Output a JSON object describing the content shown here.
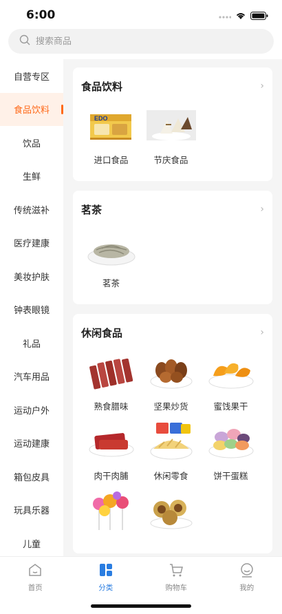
{
  "status": {
    "time": "6:00"
  },
  "search": {
    "placeholder": "搜索商品"
  },
  "sidebar": {
    "items": [
      {
        "label": "自营专区",
        "active": false
      },
      {
        "label": "食品饮料",
        "active": true
      },
      {
        "label": "饮品",
        "active": false
      },
      {
        "label": "生鲜",
        "active": false
      },
      {
        "label": "传统滋补",
        "active": false
      },
      {
        "label": "医疗建康",
        "active": false
      },
      {
        "label": "美妆护肤",
        "active": false
      },
      {
        "label": "钟表眼镜",
        "active": false
      },
      {
        "label": "礼品",
        "active": false
      },
      {
        "label": "汽车用品",
        "active": false
      },
      {
        "label": "运动户外",
        "active": false
      },
      {
        "label": "运动建康",
        "active": false
      },
      {
        "label": "箱包皮具",
        "active": false
      },
      {
        "label": "玩具乐器",
        "active": false
      },
      {
        "label": "儿童",
        "active": false
      }
    ]
  },
  "sections": [
    {
      "title": "食品饮料",
      "items": [
        {
          "label": "进口食品",
          "icon": "biscuit-box-image"
        },
        {
          "label": "节庆食品",
          "icon": "rice-dumpling-image"
        }
      ]
    },
    {
      "title": "茗茶",
      "items": [
        {
          "label": "茗茶",
          "icon": "tea-leaves-image"
        }
      ]
    },
    {
      "title": "休闲食品",
      "items": [
        {
          "label": "熟食腊味",
          "icon": "cured-meat-image"
        },
        {
          "label": "坚果炒货",
          "icon": "pecan-nuts-image"
        },
        {
          "label": "蜜饯果干",
          "icon": "dried-mango-image"
        },
        {
          "label": "肉干肉脯",
          "icon": "jerky-image"
        },
        {
          "label": "休闲零食",
          "icon": "chips-snack-image"
        },
        {
          "label": "饼干蛋糕",
          "icon": "macaron-image"
        },
        {
          "label": "",
          "icon": "lollipop-image"
        },
        {
          "label": "",
          "icon": "chocolate-ball-image"
        }
      ]
    }
  ],
  "tabbar": {
    "items": [
      {
        "label": "首页",
        "icon": "home-icon",
        "active": false
      },
      {
        "label": "分类",
        "icon": "category-icon",
        "active": true
      },
      {
        "label": "购物车",
        "icon": "cart-icon",
        "active": false
      },
      {
        "label": "我的",
        "icon": "profile-icon",
        "active": false
      }
    ]
  },
  "colors": {
    "accent": "#ff6a1a",
    "tab_active": "#2a7de1",
    "content_bg": "#f5f5f5"
  }
}
